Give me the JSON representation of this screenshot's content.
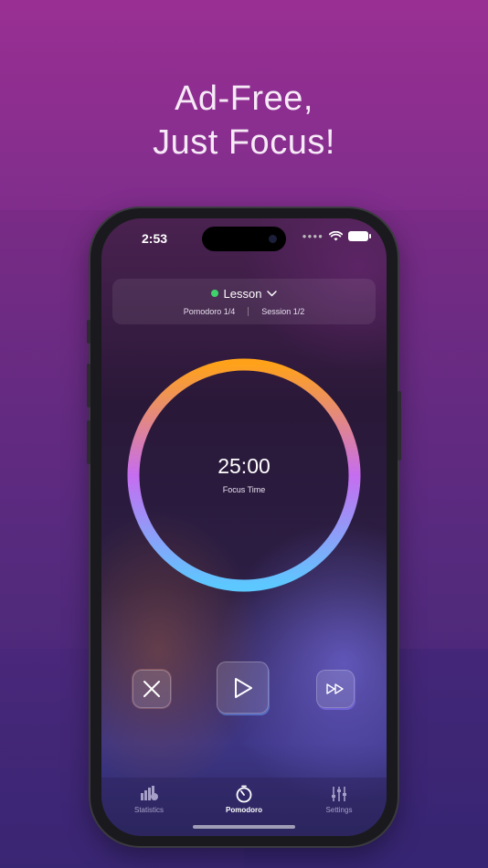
{
  "headline": {
    "line1": "Ad-Free,",
    "line2": "Just Focus!"
  },
  "status_bar": {
    "time": "2:53"
  },
  "task": {
    "name": "Lesson",
    "status_color": "#3fd36b",
    "pomodoro": "Pomodoro 1/4",
    "session": "Session 1/2"
  },
  "timer": {
    "value": "25:00",
    "label": "Focus Time",
    "ring_gradient": [
      "#ffa21a",
      "#c66df0",
      "#5cc8ff"
    ]
  },
  "controls": {
    "cancel_icon": "close-icon",
    "play_icon": "play-icon",
    "skip_icon": "fast-forward-icon"
  },
  "tabs": [
    {
      "label": "Statistics",
      "icon": "bar-chart-icon",
      "active": false
    },
    {
      "label": "Pomodoro",
      "icon": "timer-icon",
      "active": true
    },
    {
      "label": "Settings",
      "icon": "sliders-icon",
      "active": false
    }
  ]
}
